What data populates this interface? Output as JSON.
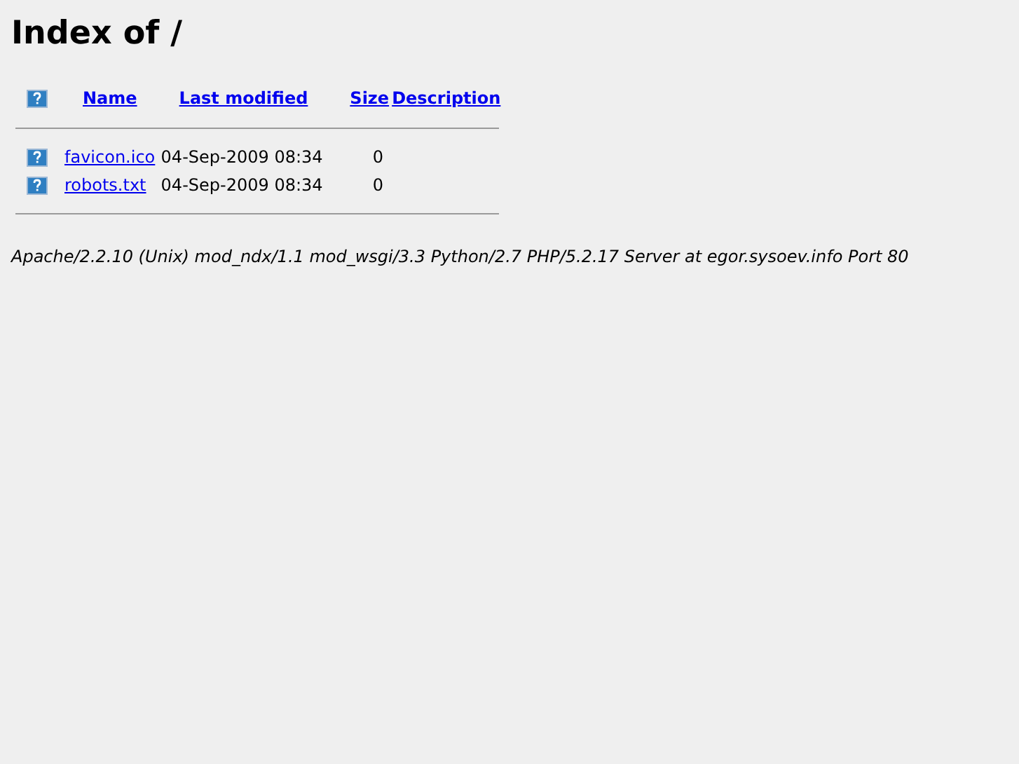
{
  "title": "Index of /",
  "columns": [
    "Name",
    "Last modified",
    "Size",
    "Description"
  ],
  "rows": [
    {
      "name": "favicon.ico",
      "modified": "04-Sep-2009 08:34",
      "size": "0"
    },
    {
      "name": "robots.txt",
      "modified": "04-Sep-2009 08:34",
      "size": "0"
    }
  ],
  "address": "Apache/2.2.10 (Unix) mod_ndx/1.1 mod_wsgi/3.3 Python/2.7 PHP/5.2.17 Server at egor.sysoev.info Port 80"
}
